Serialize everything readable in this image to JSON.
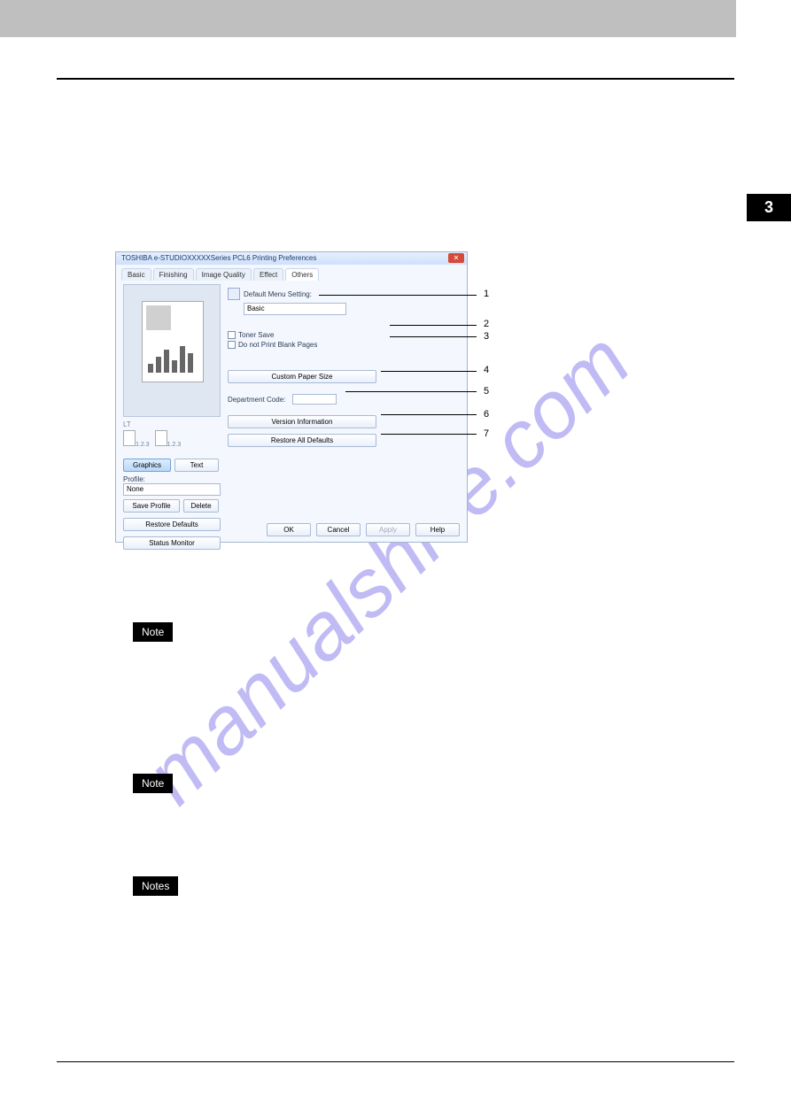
{
  "pageSideTab": "3",
  "watermark": "manualshive.com",
  "noteLabels": {
    "note": "Note",
    "notes": "Notes"
  },
  "leaderNumbers": {
    "n1": "1",
    "n2": "2",
    "n3": "3",
    "n4": "4",
    "n5": "5",
    "n6": "6",
    "n7": "7"
  },
  "dialog": {
    "title": " TOSHIBA e-STUDIOXXXXXSeries PCL6 Printing Preferences",
    "tabs": {
      "basic": "Basic",
      "finishing": "Finishing",
      "imageQuality": "Image Quality",
      "effect": "Effect",
      "others": "Others"
    },
    "right": {
      "defaultMenuSetting": "Default Menu Setting:",
      "defaultMenuValue": "Basic",
      "tonerSave": "Toner Save",
      "doNotPrintBlank": "Do not Print Blank Pages",
      "customPaperSize": "Custom Paper Size",
      "departmentCode": "Department Code:",
      "versionInformation": "Version Information",
      "restoreAllDefaults": "Restore All Defaults"
    },
    "left": {
      "lt": "LT",
      "seq": "1.2.3",
      "graphics": "Graphics",
      "text": "Text",
      "profile": "Profile:",
      "profileValue": "None",
      "saveProfile": "Save Profile",
      "delete": "Delete",
      "restoreDefaults": "Restore Defaults",
      "statusMonitor": "Status Monitor"
    },
    "footer": {
      "ok": "OK",
      "cancel": "Cancel",
      "apply": "Apply",
      "help": "Help"
    }
  }
}
